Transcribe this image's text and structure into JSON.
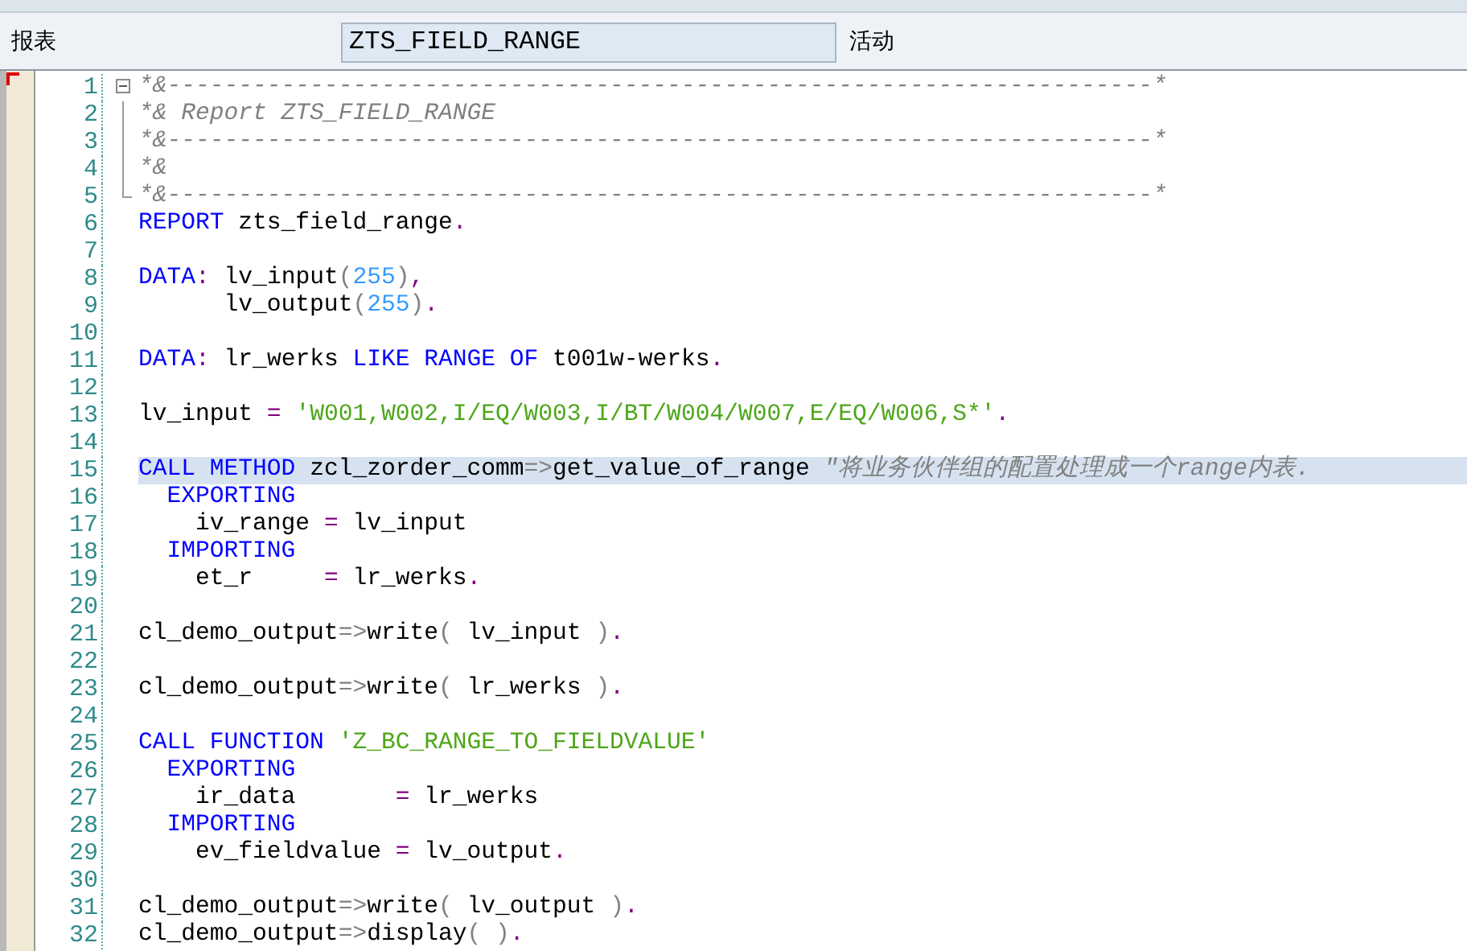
{
  "header": {
    "label": "报表",
    "program_name": "ZTS_FIELD_RANGE",
    "status": "活动"
  },
  "lines": [
    {
      "number": "1",
      "kind": "fold_start",
      "expanded": true,
      "selected": false,
      "tokens": [
        {
          "kind": "comment",
          "text": "*&---------------------------------------------------------------------*"
        }
      ]
    },
    {
      "number": "2",
      "kind": "fold_inside",
      "selected": false,
      "tokens": [
        {
          "kind": "comment",
          "text": "*& Report ZTS_FIELD_RANGE"
        }
      ]
    },
    {
      "number": "3",
      "kind": "fold_inside",
      "selected": false,
      "tokens": [
        {
          "kind": "comment",
          "text": "*&---------------------------------------------------------------------*"
        }
      ]
    },
    {
      "number": "4",
      "kind": "fold_inside",
      "selected": false,
      "tokens": [
        {
          "kind": "comment",
          "text": "*&"
        }
      ]
    },
    {
      "number": "5",
      "kind": "fold_end",
      "selected": false,
      "tokens": [
        {
          "kind": "comment",
          "text": "*&---------------------------------------------------------------------*"
        }
      ]
    },
    {
      "number": "6",
      "kind": "code",
      "selected": false,
      "tokens": [
        {
          "kind": "keyword",
          "text": "REPORT"
        },
        {
          "kind": "ident",
          "text": " zts_field_range"
        },
        {
          "kind": "op",
          "text": "."
        }
      ]
    },
    {
      "number": "7",
      "kind": "code",
      "selected": false
    },
    {
      "number": "8",
      "kind": "code",
      "selected": false,
      "tokens": [
        {
          "kind": "keyword",
          "text": "DATA"
        },
        {
          "kind": "op",
          "text": ":"
        },
        {
          "kind": "ident",
          "text": " lv_input"
        },
        {
          "kind": "punct",
          "text": "("
        },
        {
          "kind": "number",
          "text": "255"
        },
        {
          "kind": "punct",
          "text": ")"
        },
        {
          "kind": "op",
          "text": ","
        }
      ]
    },
    {
      "number": "9",
      "kind": "code",
      "selected": false,
      "tokens": [
        {
          "kind": "ident",
          "text": "      lv_output"
        },
        {
          "kind": "punct",
          "text": "("
        },
        {
          "kind": "number",
          "text": "255"
        },
        {
          "kind": "punct",
          "text": ")"
        },
        {
          "kind": "op",
          "text": "."
        }
      ]
    },
    {
      "number": "10",
      "kind": "code",
      "selected": false
    },
    {
      "number": "11",
      "kind": "code",
      "selected": false,
      "tokens": [
        {
          "kind": "keyword",
          "text": "DATA"
        },
        {
          "kind": "op",
          "text": ":"
        },
        {
          "kind": "ident",
          "text": " lr_werks "
        },
        {
          "kind": "keyword",
          "text": "LIKE RANGE OF"
        },
        {
          "kind": "ident",
          "text": " t001w-werks"
        },
        {
          "kind": "op",
          "text": "."
        }
      ]
    },
    {
      "number": "12",
      "kind": "code",
      "selected": false
    },
    {
      "number": "13",
      "kind": "code",
      "selected": false,
      "tokens": [
        {
          "kind": "ident",
          "text": "lv_input "
        },
        {
          "kind": "op",
          "text": "="
        },
        {
          "kind": "string",
          "text": " 'W001,W002,I/EQ/W003,I/BT/W004/W007,E/EQ/W006,S*'"
        },
        {
          "kind": "op",
          "text": "."
        }
      ]
    },
    {
      "number": "14",
      "kind": "code",
      "selected": false
    },
    {
      "number": "15",
      "kind": "code",
      "selected": true,
      "tokens": [
        {
          "kind": "keyword",
          "text": "CALL METHOD"
        },
        {
          "kind": "ident",
          "text": " zcl_zorder_comm"
        },
        {
          "kind": "punct",
          "text": "=>"
        },
        {
          "kind": "ident",
          "text": "get_value_of_range "
        },
        {
          "kind": "comment",
          "text": "\"将业务伙伴组的配置处理成一个range内表."
        }
      ]
    },
    {
      "number": "16",
      "kind": "code",
      "selected": false,
      "tokens": [
        {
          "kind": "keyword",
          "text": "  EXPORTING"
        }
      ]
    },
    {
      "number": "17",
      "kind": "code",
      "selected": false,
      "tokens": [
        {
          "kind": "ident",
          "text": "    iv_range "
        },
        {
          "kind": "op",
          "text": "="
        },
        {
          "kind": "ident",
          "text": " lv_input"
        }
      ]
    },
    {
      "number": "18",
      "kind": "code",
      "selected": false,
      "tokens": [
        {
          "kind": "keyword",
          "text": "  IMPORTING"
        }
      ]
    },
    {
      "number": "19",
      "kind": "code",
      "selected": false,
      "tokens": [
        {
          "kind": "ident",
          "text": "    et_r     "
        },
        {
          "kind": "op",
          "text": "="
        },
        {
          "kind": "ident",
          "text": " lr_werks"
        },
        {
          "kind": "op",
          "text": "."
        }
      ]
    },
    {
      "number": "20",
      "kind": "code",
      "selected": false
    },
    {
      "number": "21",
      "kind": "code",
      "selected": false,
      "tokens": [
        {
          "kind": "ident",
          "text": "cl_demo_output"
        },
        {
          "kind": "punct",
          "text": "=>"
        },
        {
          "kind": "ident",
          "text": "write"
        },
        {
          "kind": "punct",
          "text": "("
        },
        {
          "kind": "ident",
          "text": " lv_input "
        },
        {
          "kind": "punct",
          "text": ")"
        },
        {
          "kind": "op",
          "text": "."
        }
      ]
    },
    {
      "number": "22",
      "kind": "code",
      "selected": false
    },
    {
      "number": "23",
      "kind": "code",
      "selected": false,
      "tokens": [
        {
          "kind": "ident",
          "text": "cl_demo_output"
        },
        {
          "kind": "punct",
          "text": "=>"
        },
        {
          "kind": "ident",
          "text": "write"
        },
        {
          "kind": "punct",
          "text": "("
        },
        {
          "kind": "ident",
          "text": " lr_werks "
        },
        {
          "kind": "punct",
          "text": ")"
        },
        {
          "kind": "op",
          "text": "."
        }
      ]
    },
    {
      "number": "24",
      "kind": "code",
      "selected": false
    },
    {
      "number": "25",
      "kind": "code",
      "selected": false,
      "tokens": [
        {
          "kind": "keyword",
          "text": "CALL FUNCTION"
        },
        {
          "kind": "string",
          "text": " 'Z_BC_RANGE_TO_FIELDVALUE'"
        }
      ]
    },
    {
      "number": "26",
      "kind": "code",
      "selected": false,
      "tokens": [
        {
          "kind": "keyword",
          "text": "  EXPORTING"
        }
      ]
    },
    {
      "number": "27",
      "kind": "code",
      "selected": false,
      "tokens": [
        {
          "kind": "ident",
          "text": "    ir_data       "
        },
        {
          "kind": "op",
          "text": "="
        },
        {
          "kind": "ident",
          "text": " lr_werks"
        }
      ]
    },
    {
      "number": "28",
      "kind": "code",
      "selected": false,
      "tokens": [
        {
          "kind": "keyword",
          "text": "  IMPORTING"
        }
      ]
    },
    {
      "number": "29",
      "kind": "code",
      "selected": false,
      "tokens": [
        {
          "kind": "ident",
          "text": "    ev_fieldvalue "
        },
        {
          "kind": "op",
          "text": "="
        },
        {
          "kind": "ident",
          "text": " lv_output"
        },
        {
          "kind": "op",
          "text": "."
        }
      ]
    },
    {
      "number": "30",
      "kind": "code",
      "selected": false
    },
    {
      "number": "31",
      "kind": "code",
      "selected": false,
      "tokens": [
        {
          "kind": "ident",
          "text": "cl_demo_output"
        },
        {
          "kind": "punct",
          "text": "=>"
        },
        {
          "kind": "ident",
          "text": "write"
        },
        {
          "kind": "punct",
          "text": "("
        },
        {
          "kind": "ident",
          "text": " lv_output "
        },
        {
          "kind": "punct",
          "text": ")"
        },
        {
          "kind": "op",
          "text": "."
        }
      ]
    },
    {
      "number": "32",
      "kind": "code",
      "selected": false,
      "tokens": [
        {
          "kind": "ident",
          "text": "cl_demo_output"
        },
        {
          "kind": "punct",
          "text": "=>"
        },
        {
          "kind": "ident",
          "text": "display"
        },
        {
          "kind": "punct",
          "text": "( )"
        },
        {
          "kind": "op",
          "text": "."
        }
      ]
    }
  ]
}
